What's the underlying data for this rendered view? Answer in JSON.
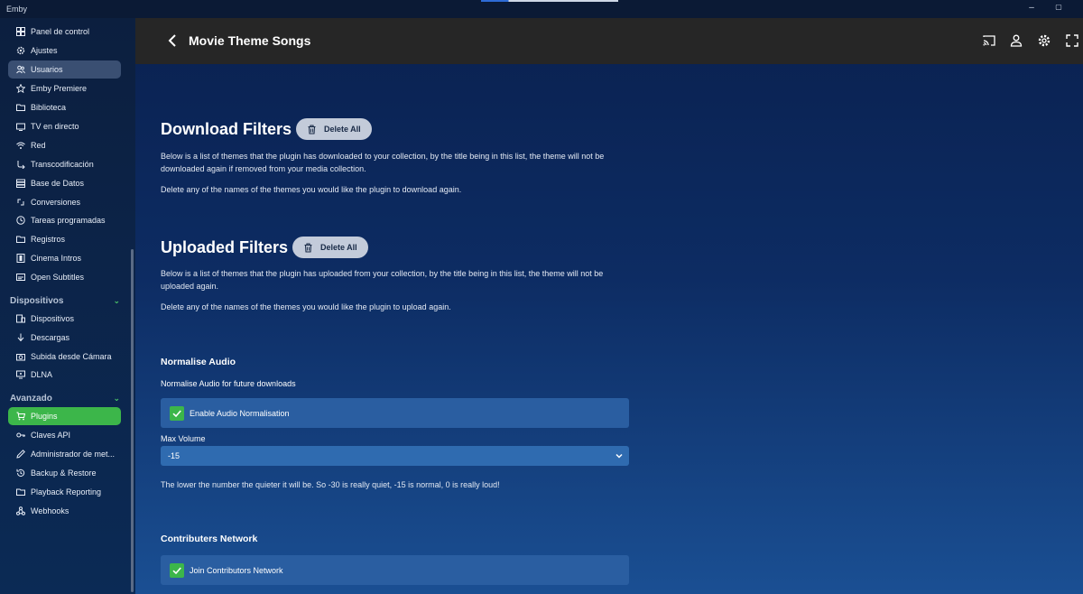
{
  "window": {
    "app_name": "Emby",
    "minimize_glyph": "–",
    "maximize_glyph": "▢"
  },
  "sidebar": {
    "items": [
      {
        "label": "Panel de control",
        "icon": "dashboard-icon"
      },
      {
        "label": "Ajustes",
        "icon": "gear-icon"
      },
      {
        "label": "Usuarios",
        "icon": "users-icon",
        "active": true
      },
      {
        "label": "Emby Premiere",
        "icon": "star-icon"
      },
      {
        "label": "Biblioteca",
        "icon": "folder-icon"
      },
      {
        "label": "TV en directo",
        "icon": "tv-icon"
      },
      {
        "label": "Red",
        "icon": "wifi-icon"
      },
      {
        "label": "Transcodificación",
        "icon": "transcode-icon"
      },
      {
        "label": "Base de Datos",
        "icon": "database-icon"
      },
      {
        "label": "Conversiones",
        "icon": "sync-icon"
      },
      {
        "label": "Tareas programadas",
        "icon": "clock-icon"
      },
      {
        "label": "Registros",
        "icon": "folder-icon"
      },
      {
        "label": "Cinema Intros",
        "icon": "film-icon"
      },
      {
        "label": "Open Subtitles",
        "icon": "subtitles-icon"
      }
    ],
    "devices_section": {
      "title": "Dispositivos",
      "chevron": "⌄",
      "items": [
        {
          "label": "Dispositivos",
          "icon": "devices-icon"
        },
        {
          "label": "Descargas",
          "icon": "download-icon"
        },
        {
          "label": "Subida desde Cámara",
          "icon": "camera-icon"
        },
        {
          "label": "DLNA",
          "icon": "dlna-icon"
        }
      ]
    },
    "advanced_section": {
      "title": "Avanzado",
      "chevron": "⌄",
      "items": [
        {
          "label": "Plugins",
          "icon": "cart-icon",
          "highlight": true
        },
        {
          "label": "Claves API",
          "icon": "key-icon"
        },
        {
          "label": "Administrador de met...",
          "icon": "pencil-icon"
        },
        {
          "label": "Backup & Restore",
          "icon": "restore-icon"
        },
        {
          "label": "Playback Reporting",
          "icon": "folder-icon"
        },
        {
          "label": "Webhooks",
          "icon": "webhook-icon"
        }
      ]
    }
  },
  "header": {
    "title": "Movie Theme Songs"
  },
  "download_filters": {
    "title": "Download Filters",
    "delete_all_label": "Delete All",
    "description": "Below is a list of themes that the plugin has downloaded to your collection, by the title being in this list, the theme will not be downloaded again if removed from your media collection.",
    "note": "Delete any of the names of the themes you would like the plugin to download again."
  },
  "uploaded_filters": {
    "title": "Uploaded Filters",
    "delete_all_label": "Delete All",
    "description": "Below is a list of themes that the plugin has uploaded from your collection, by the title being in this list, the theme will not be uploaded again.",
    "note": "Delete any of the names of the themes you would like the plugin to upload again."
  },
  "normalise_audio": {
    "title": "Normalise Audio",
    "subtitle": "Normalise Audio for future downloads",
    "checkbox_label": "Enable Audio Normalisation",
    "checked": true,
    "max_volume_label": "Max Volume",
    "max_volume_value": "-15",
    "hint": "The lower the number the quieter it will be. So -30 is really quiet, -15 is normal, 0 is really loud!"
  },
  "contributors": {
    "title": "Contributers Network",
    "checkbox_label": "Join Contributors Network",
    "checked": true
  },
  "colors": {
    "accent_green": "#3cb64a",
    "header_bg": "#262626",
    "input_bg": "#2a5ea1"
  }
}
